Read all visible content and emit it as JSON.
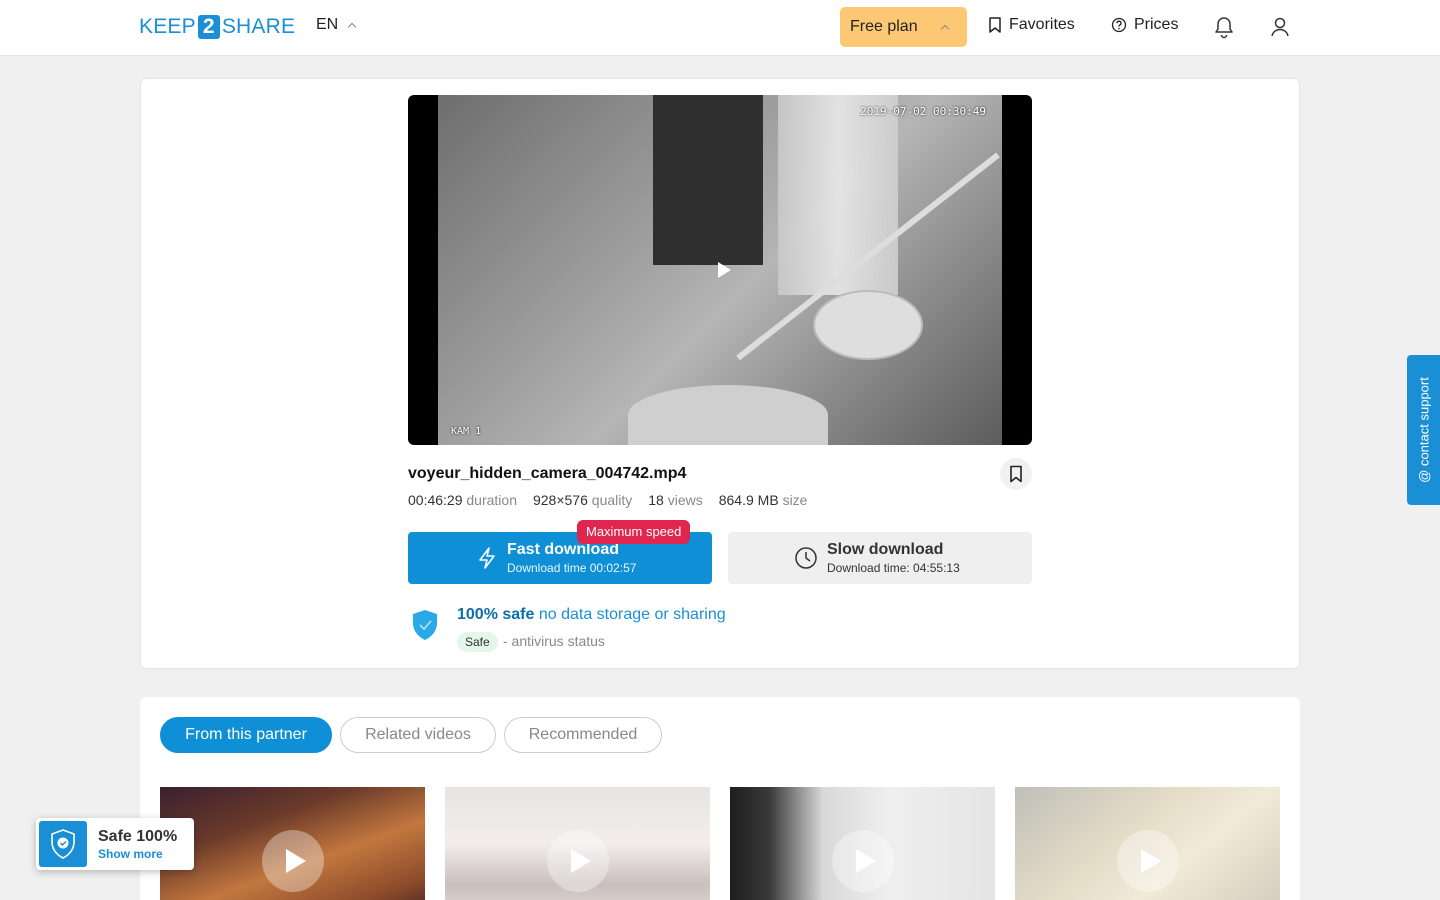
{
  "header": {
    "logo_left": "KEEP",
    "logo_mid": "2",
    "logo_right": "SHARE",
    "language": "EN",
    "plan_label": "Free plan",
    "favorites_label": "Favorites",
    "prices_label": "Prices"
  },
  "player": {
    "timestamp": "2019-07-02 00:30:49",
    "cam_label": "KAM 1"
  },
  "file": {
    "name": "voyeur_hidden_camera_004742.mp4",
    "duration_value": "00:46:29",
    "duration_unit": "duration",
    "quality_value": "928×576",
    "quality_unit": "quality",
    "views_value": "18",
    "views_unit": "views",
    "size_value": "864.9 MB",
    "size_unit": "size"
  },
  "download": {
    "badge": "Maximum speed",
    "fast_title": "Fast download",
    "fast_time": "Download time 00:02:57",
    "slow_title": "Slow download",
    "slow_time": "Download time: 04:55:13"
  },
  "safety": {
    "bold": "100% safe",
    "rest": "no data storage or sharing",
    "chip": "Safe",
    "status": "- antivirus status"
  },
  "tabs": [
    "From this partner",
    "Related videos",
    "Recommended"
  ],
  "support": {
    "label": "@ contact support"
  },
  "safe_widget": {
    "title": "Safe 100%",
    "more": "Show more"
  },
  "colors": {
    "accent": "#0f8fd6",
    "plan": "#fcc873",
    "badge": "#e0264e"
  }
}
